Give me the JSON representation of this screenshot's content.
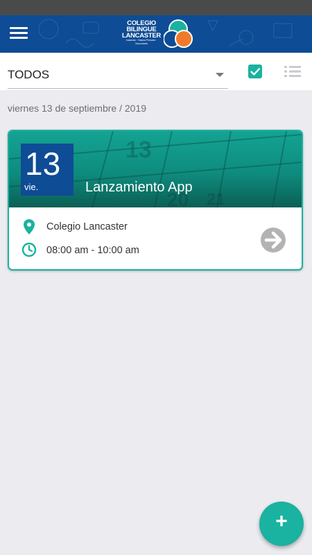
{
  "app": {
    "logo_lines": [
      "COLEGIO",
      "BILINGUE",
      "LANCASTER"
    ],
    "logo_tagline": "Inasedon · Básica Primaria · Secundaria",
    "colors": {
      "primary": "#0e4c95",
      "accent": "#1ab2a0",
      "logo_orange": "#f07a2b"
    }
  },
  "toolbar": {
    "menu_icon": "hamburger-menu-icon",
    "filter_value": "TODOS",
    "check_icon": "checkbox-checked-icon",
    "list_icon": "list-view-icon"
  },
  "date_heading": "viernes 13 de septiembre / 2019",
  "events": [
    {
      "day": "13",
      "weekday": "vie.",
      "title": "Lanzamiento App",
      "location": "Colegio Lancaster",
      "time": "08:00 am - 10:00 am",
      "location_icon": "map-pin-icon",
      "time_icon": "clock-icon",
      "open_icon": "arrow-right-circle-icon"
    }
  ],
  "fab": {
    "label": "+",
    "icon": "plus-icon"
  }
}
